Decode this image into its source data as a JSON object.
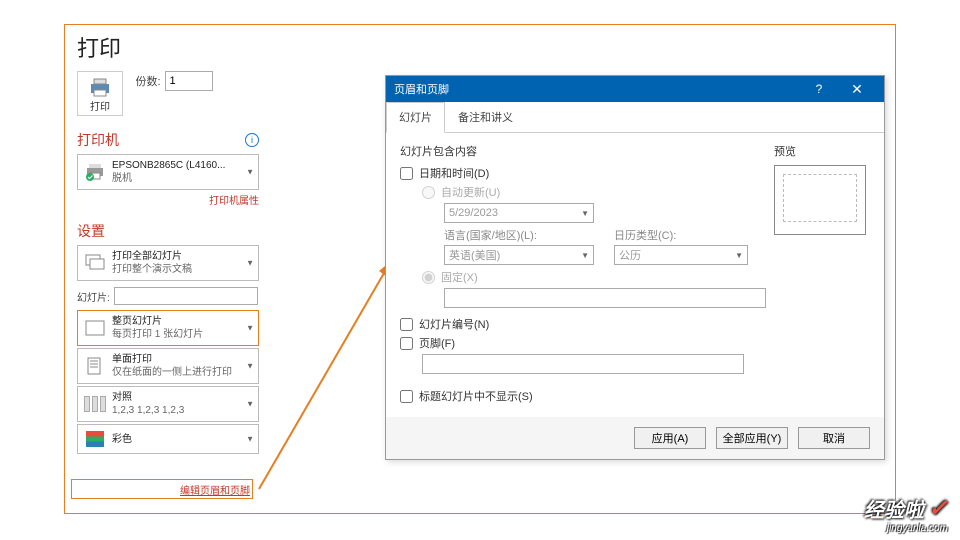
{
  "print": {
    "title": "打印",
    "button_label": "打印",
    "copies_label": "份数:",
    "copies_value": "1",
    "printer_section": "打印机",
    "printer_name": "EPSONB2865C (L4160...",
    "printer_status": "脱机",
    "printer_props_link": "打印机属性",
    "settings_section": "设置",
    "scope_title": "打印全部幻灯片",
    "scope_sub": "打印整个演示文稿",
    "slides_label": "幻灯片:",
    "layout_title": "整页幻灯片",
    "layout_sub": "每页打印 1 张幻灯片",
    "duplex_title": "单面打印",
    "duplex_sub": "仅在纸面的一侧上进行打印",
    "collate_title": "对照",
    "collate_sub": "1,2,3   1,2,3   1,2,3",
    "color_title": "彩色",
    "edit_hf_link": "编辑页眉和页脚"
  },
  "dialog": {
    "title": "页眉和页脚",
    "tab_slide": "幻灯片",
    "tab_notes": "备注和讲义",
    "group_title": "幻灯片包含内容",
    "chk_datetime": "日期和时间(D)",
    "radio_auto": "自动更新(U)",
    "date_value": "5/29/2023",
    "lang_label": "语言(国家/地区)(L):",
    "lang_value": "英语(美国)",
    "cal_label": "日历类型(C):",
    "cal_value": "公历",
    "radio_fixed": "固定(X)",
    "chk_slideno": "幻灯片编号(N)",
    "chk_footer": "页脚(F)",
    "chk_hide_title": "标题幻灯片中不显示(S)",
    "preview_label": "预览",
    "btn_apply": "应用(A)",
    "btn_apply_all": "全部应用(Y)",
    "btn_cancel": "取消"
  },
  "watermark": {
    "line1": "经验啦",
    "line2": "jingyanla.com"
  }
}
